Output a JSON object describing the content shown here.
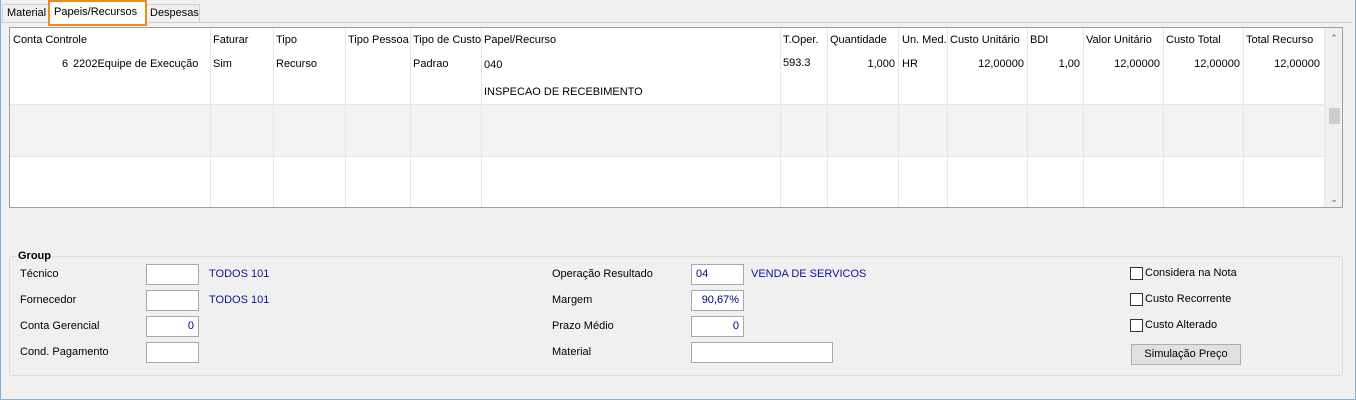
{
  "tabs": [
    {
      "label": "Material"
    },
    {
      "label": "Papeis/Recursos"
    },
    {
      "label": "Despesas"
    }
  ],
  "grid": {
    "headers": [
      "Conta Controle",
      "Faturar",
      "Tipo",
      "Tipo Pessoa",
      "Tipo de Custo",
      "Papel/Recurso",
      "T.Oper.",
      "Quantidade",
      "Un. Med.",
      "Custo Unitário",
      "BDI",
      "Valor Unitário",
      "Custo Total",
      "Total Recurso"
    ],
    "row1": {
      "conta_num": "6",
      "conta_desc": "2202Equipe de Execução",
      "faturar": "Sim",
      "tipo": "Recurso",
      "tipo_pessoa": "",
      "tipo_custo": "Padrao",
      "papel_code": "040",
      "papel_desc": "INSPECAO DE RECEBIMENTO",
      "t_oper": "593.3",
      "quantidade": "1,000",
      "un_med": "HR",
      "custo_unitario": "12,00000",
      "bdi": "1,00",
      "valor_unitario": "12,00000",
      "custo_total": "12,00000",
      "total_recurso": "12,00000"
    }
  },
  "group": {
    "title": "Group",
    "tecnico": {
      "label": "Técnico",
      "value": "",
      "info": "TODOS  101"
    },
    "fornecedor": {
      "label": "Fornecedor",
      "value": "",
      "info": "TODOS  101"
    },
    "conta_gerencial": {
      "label": "Conta Gerencial",
      "value": "0"
    },
    "cond_pagamento": {
      "label": "Cond. Pagamento",
      "value": ""
    },
    "operacao_resultado": {
      "label": "Operação Resultado",
      "value": "04",
      "info": "VENDA DE SERVICOS"
    },
    "margem": {
      "label": "Margem",
      "value": "90,67%"
    },
    "prazo_medio": {
      "label": "Prazo Médio",
      "value": "0"
    },
    "material": {
      "label": "Material",
      "value": ""
    },
    "considera_nota": {
      "label": "Considera na Nota",
      "checked": false
    },
    "custo_recorrente": {
      "label": "Custo Recorrente",
      "checked": false
    },
    "custo_alterado": {
      "label": "Custo Alterado",
      "checked": false
    },
    "simulacao_button": "Simulação Preço"
  }
}
